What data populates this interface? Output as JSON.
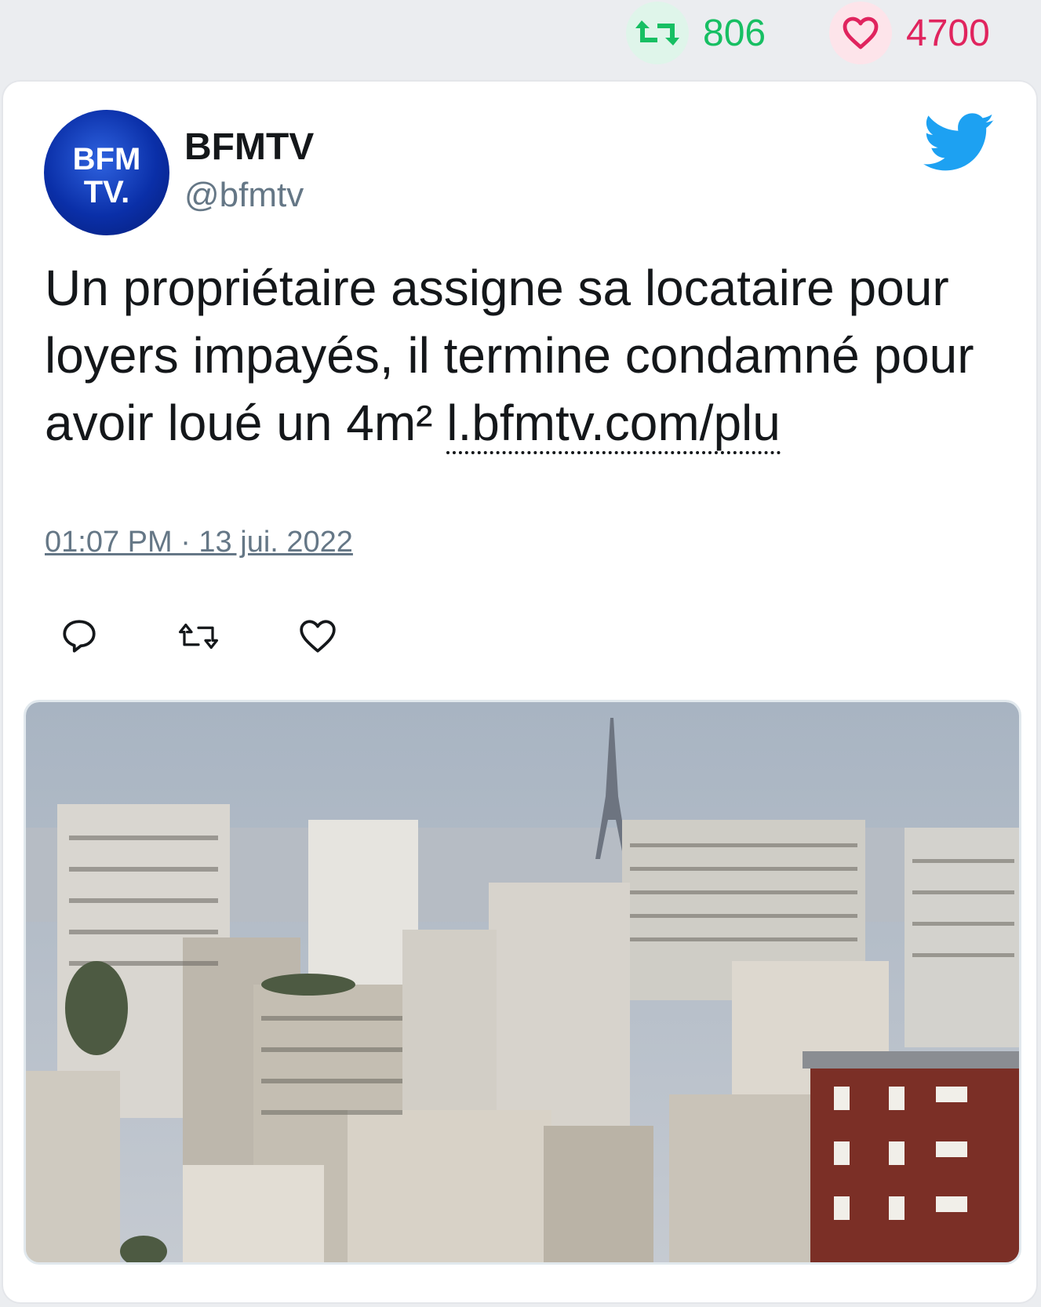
{
  "stats": {
    "retweets": "806",
    "likes": "4700",
    "retweet_icon": "retweet-icon",
    "like_icon": "heart-icon",
    "retweet_color": "#17bf63",
    "like_color": "#e0245e"
  },
  "tweet": {
    "author_name": "BFMTV",
    "author_handle": "@bfmtv",
    "avatar_text_line1": "BFM",
    "avatar_text_line2": "TV.",
    "text": "Un propriétaire assigne sa locataire pour loyers impayés, il termine condamné pour avoir loué un 4m²",
    "link_text": "l.bfmtv.com/plu",
    "timestamp": "01:07 PM · 13 jui. 2022",
    "brand_color": "#1da1f2"
  },
  "actions": [
    {
      "icon": "reply-icon"
    },
    {
      "icon": "retweet-icon"
    },
    {
      "icon": "like-icon"
    }
  ],
  "media": {
    "description_icon": "paris-skyline-photo"
  }
}
